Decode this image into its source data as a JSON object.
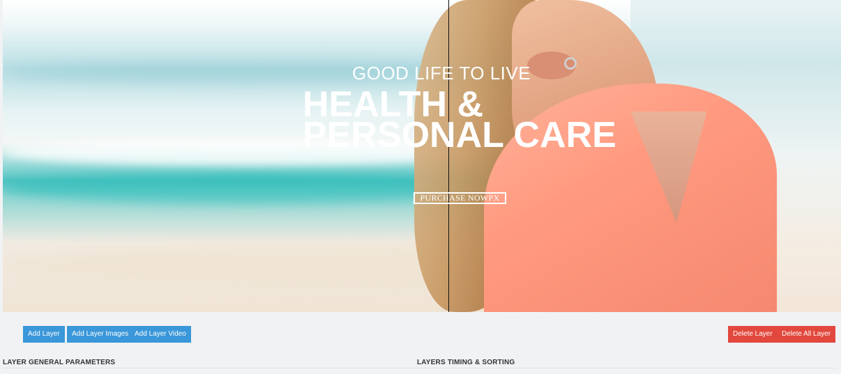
{
  "slide": {
    "subtitle": "GOOD LIFE TO LIVE",
    "headline_line1": "HEALTH &",
    "headline_line2": "PERSONAL CARE",
    "button_label": "PURCHASE NOWPX"
  },
  "toolbar": {
    "add_layer": "Add Layer",
    "add_layer_images": "Add Layer Images",
    "add_layer_video": "Add Layer Video",
    "delete_layer": "Delete Layer",
    "delete_all_layer": "Delete All Layer"
  },
  "sections": {
    "general": "LAYER GENERAL PARAMETERS",
    "timing": "LAYERS TIMING & SORTING"
  },
  "colors": {
    "primary": "#3a97d9",
    "danger": "#e2483d",
    "panel_bg": "#f1f2f4"
  }
}
